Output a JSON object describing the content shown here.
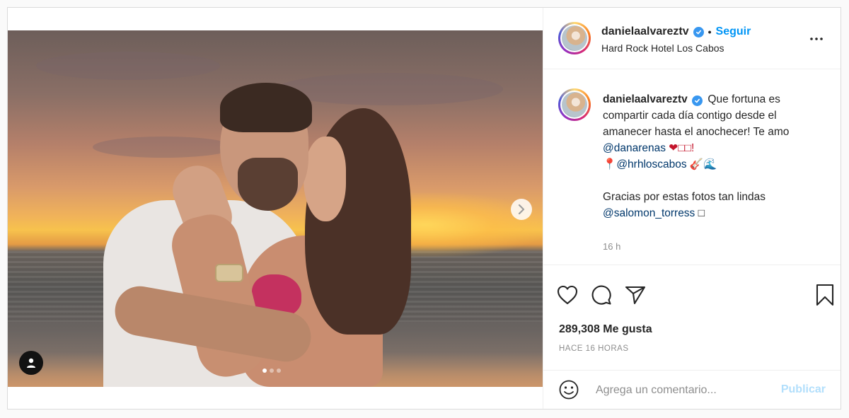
{
  "post": {
    "username": "danielaalvareztv",
    "verified": true,
    "follow_separator": "•",
    "follow_label": "Seguir",
    "location": "Hard Rock Hotel Los Cabos",
    "more_label": "•••"
  },
  "media": {
    "carousel_count": 3,
    "carousel_active": 0
  },
  "caption": {
    "username": "danielaalvareztv",
    "line1": "Que fortuna es compartir cada día contigo desde el amanecer hasta el anochecer! Te amo",
    "mention1": "@danarenas",
    "after_mention1": " ❤□□!",
    "pin": "📍",
    "mention2": "@hrhloscabos",
    "after_mention2": " 🎸🌊",
    "line_thanks": "Gracias por estas fotos tan lindas",
    "mention3": "@salomon_torress",
    "after_mention3": " □",
    "time": "16 h"
  },
  "stats": {
    "likes": "289,308 Me gusta",
    "posted": "HACE 16 HORAS"
  },
  "comment_box": {
    "placeholder": "Agrega un comentario...",
    "publish_label": "Publicar"
  },
  "icons": {
    "like": "heart-icon",
    "comment": "comment-icon",
    "share": "send-icon",
    "save": "bookmark-icon",
    "emoji": "emoji-icon",
    "next": "chevron-right-icon",
    "tag": "user-tag-icon"
  },
  "colors": {
    "link": "#0095f6",
    "mention": "#00376b",
    "muted": "#8e8e8e",
    "publish_disabled": "#b2dffc",
    "verified": "#3897f0"
  }
}
